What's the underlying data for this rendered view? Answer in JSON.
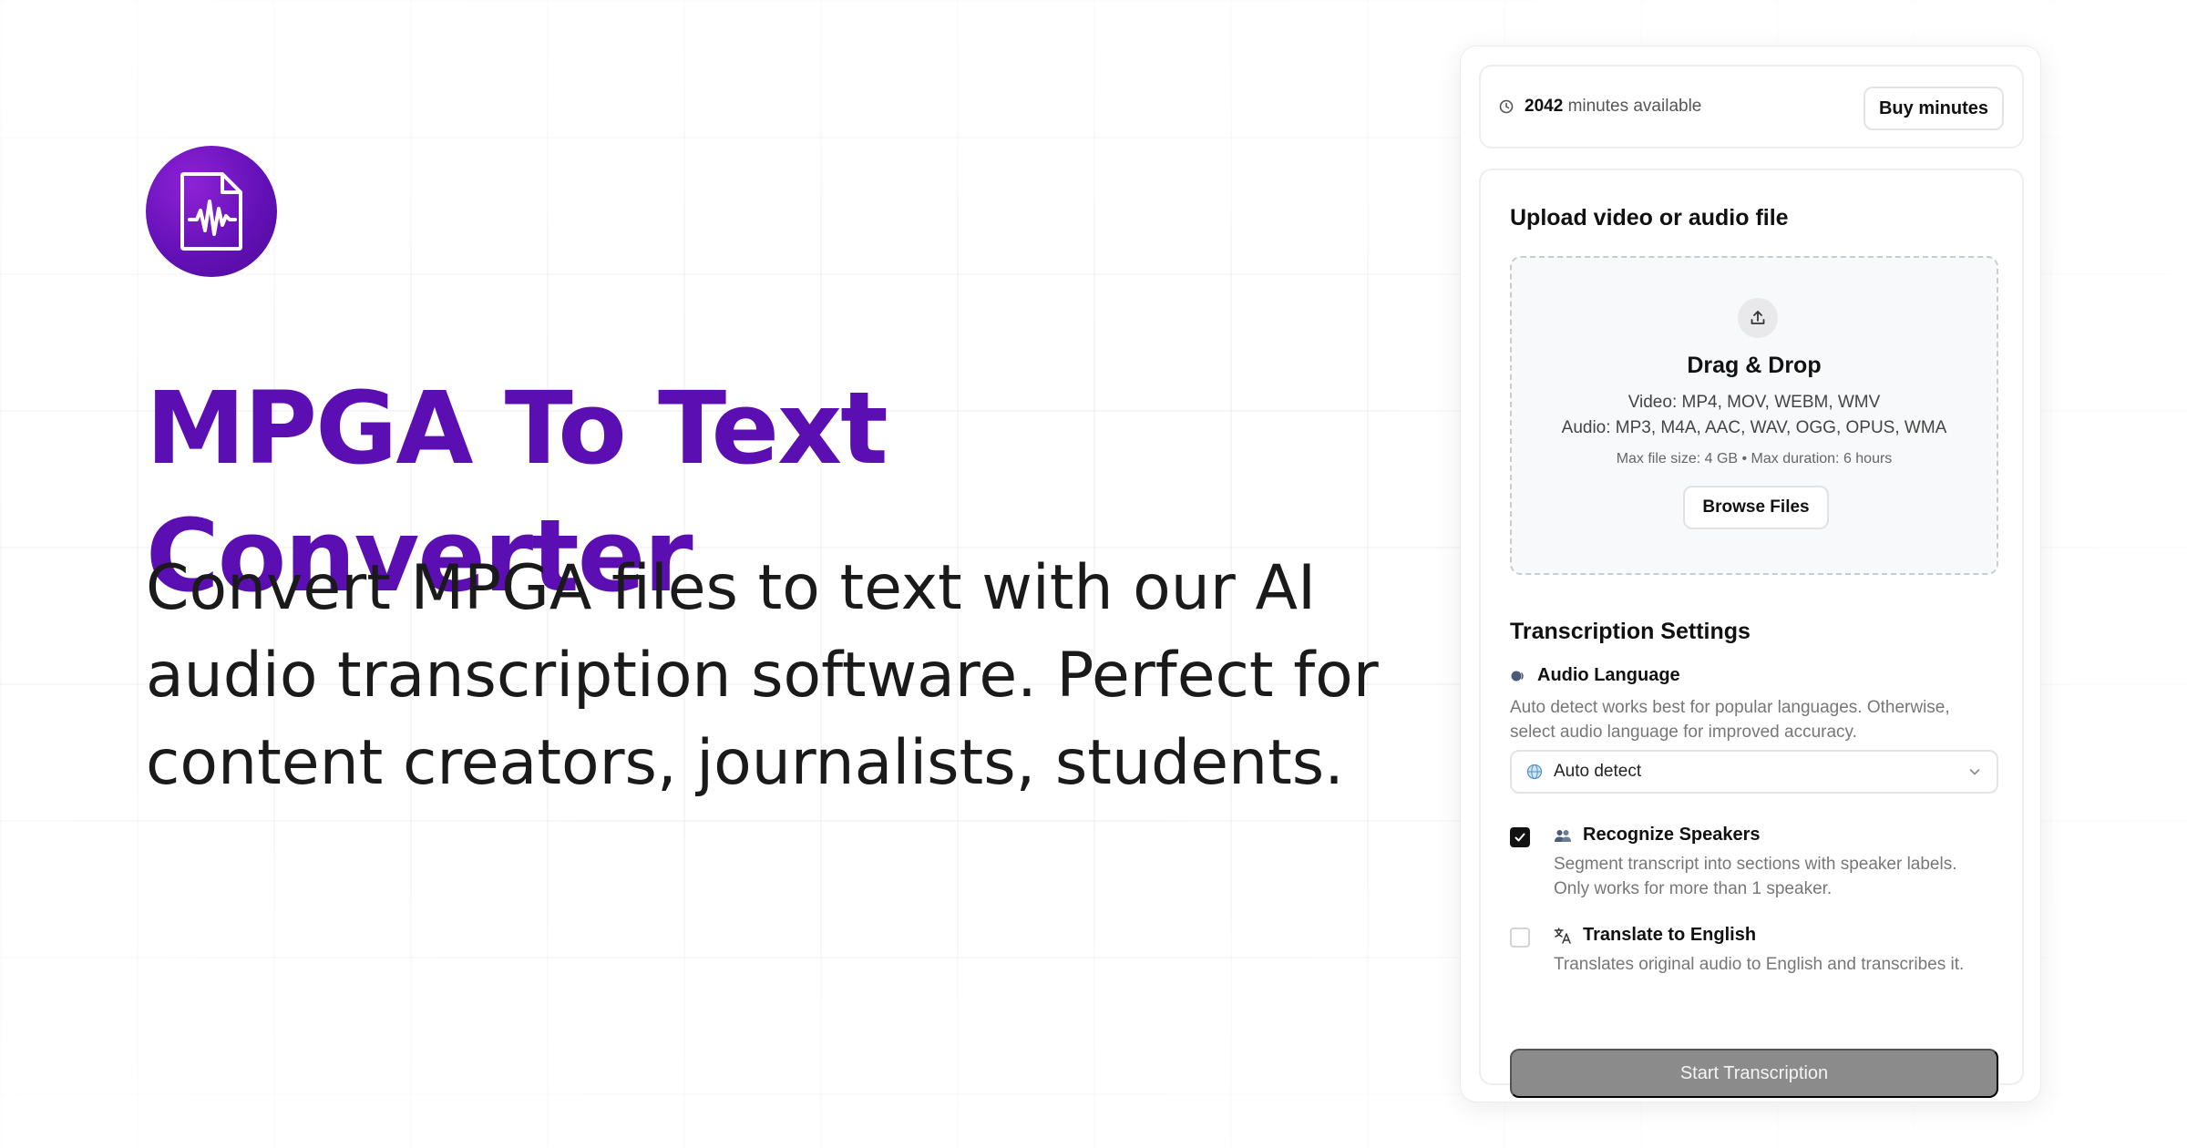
{
  "hero": {
    "title": "MPGA To Text Converter",
    "subtitle_line1": "Convert MPGA files to text with our AI",
    "subtitle_line2": "audio transcription software. Perfect for",
    "subtitle_line3": "content creators, journalists, students.",
    "logo_icon": "audio-file-waveform-icon"
  },
  "minutes": {
    "count": "2042",
    "suffix": "minutes available",
    "buy_label": "Buy minutes",
    "icon": "clock-icon"
  },
  "upload": {
    "title": "Upload video or audio file",
    "drag_label": "Drag & Drop",
    "video_formats": "Video: MP4, MOV, WEBM, WMV",
    "audio_formats": "Audio: MP3, M4A, AAC, WAV, OGG, OPUS, WMA",
    "limits": "Max file size: 4 GB • Max duration: 6 hours",
    "browse_label": "Browse Files",
    "icon": "upload-icon"
  },
  "settings": {
    "title": "Transcription Settings",
    "language": {
      "label": "Audio Language",
      "desc_line1": "Auto detect works best for popular languages. Otherwise,",
      "desc_line2": "select audio language for improved accuracy.",
      "selected": "Auto detect",
      "icon": "speaking-head-icon",
      "select_icon": "globe-icon"
    },
    "speakers": {
      "label": "Recognize Speakers",
      "desc_line1": "Segment transcript into sections with speaker labels.",
      "desc_line2": "Only works for more than 1 speaker.",
      "checked": true,
      "icon": "people-icon"
    },
    "translate": {
      "label": "Translate to English",
      "desc": "Translates original audio to English and transcribes it.",
      "checked": false,
      "icon": "translate-icon"
    }
  },
  "start_label": "Start Transcription",
  "colors": {
    "brand": "#5b0fb3",
    "start_disabled": "#8b8b8b"
  }
}
